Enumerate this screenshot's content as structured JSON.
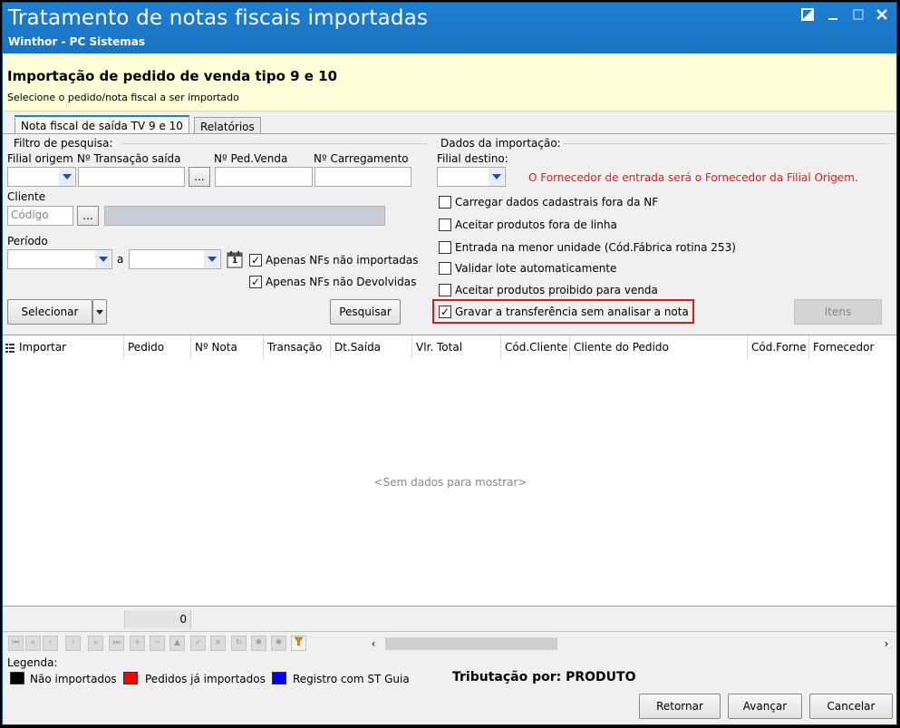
{
  "window": {
    "title": "Tratamento de notas fiscais importadas",
    "subtitle": "Winthor - PC Sistemas"
  },
  "header": {
    "title": "Importação de pedido de venda tipo 9 e 10",
    "subtitle": "Selecione o pedido/nota fiscal a ser importado"
  },
  "tabs": [
    {
      "label": "Nota fiscal de saída TV 9 e 10",
      "active": true
    },
    {
      "label": "Relatórios",
      "active": false
    }
  ],
  "filter": {
    "group_label": "Filtro de pesquisa:",
    "filial_origem_label": "Filial origem",
    "transacao_label": "Nº Transação saída",
    "ped_venda_label": "Nº Ped.Venda",
    "carregamento_label": "Nº Carregamento",
    "ellipsis": "...",
    "cliente_label": "Cliente",
    "cliente_placeholder": "Código",
    "periodo_label": "Período",
    "periodo_sep": "a",
    "calendar_day": "1",
    "apenas_nao_importadas": "Apenas NFs não importadas",
    "apenas_nao_devolvidas": "Apenas NFs não Devolvidas",
    "selecionar_button": "Selecionar",
    "pesquisar_button": "Pesquisar"
  },
  "import": {
    "group_label": "Dados da importação:",
    "filial_destino_label": "Filial destino:",
    "warning": "O Fornecedor de entrada será o Fornecedor da Filial Origem.",
    "warning_color": "#e02020",
    "options": [
      {
        "label": "Carregar dados cadastrais fora da NF",
        "checked": false
      },
      {
        "label": "Aceitar produtos fora de linha",
        "checked": false
      },
      {
        "label": "Entrada na menor unidade (Cód.Fábrica rotina 253)",
        "checked": false
      },
      {
        "label": "Validar lote automaticamente",
        "checked": false
      },
      {
        "label": "Aceitar produtos proibido para venda",
        "checked": false
      },
      {
        "label": "Gravar a transferência sem analisar a nota",
        "checked": true
      }
    ],
    "itens_button": "Itens"
  },
  "grid": {
    "columns": [
      "Importar",
      "Pedido",
      "Nº Nota",
      "Transação",
      "Dt.Saída",
      "Vlr. Total",
      "Cód.Cliente",
      "Cliente do Pedido",
      "Cód.Forne",
      "Fornecedor"
    ],
    "empty_message": "<Sem dados para mostrar>",
    "footer_total": "0"
  },
  "legend": {
    "title": "Legenda:",
    "items": [
      {
        "label": "Não importados",
        "color": "#000000"
      },
      {
        "label": "Pedidos já importados",
        "color": "#ff0000"
      },
      {
        "label": "Registro com ST Guia",
        "color": "#0000ff"
      }
    ],
    "tributacao": "Tributação por: PRODUTO"
  },
  "buttons": {
    "retornar": "Retornar",
    "avancar": "Avançar",
    "cancelar": "Cancelar"
  }
}
